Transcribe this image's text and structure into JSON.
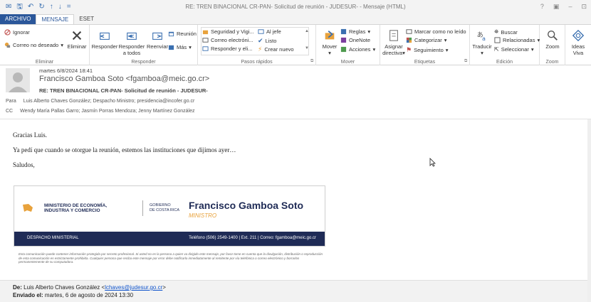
{
  "window": {
    "title": "RE: TREN BINACIONAL CR-PAN- Solicitud de reunión - JUDESUR- - Mensaje (HTML)",
    "controls": [
      "?",
      "▣",
      "–",
      "⊡"
    ]
  },
  "tabs": [
    "ARCHIVO",
    "MENSAJE",
    "ESET"
  ],
  "ribbon": {
    "eliminar": {
      "label": "Eliminar",
      "ignorar": "Ignorar",
      "correo_no_deseado": "Correo no deseado",
      "eliminar_btn": "Eliminar"
    },
    "responder": {
      "label": "Responder",
      "responder": "Responder",
      "responder_todos_1": "Responder",
      "responder_todos_2": "a todos",
      "reenviar": "Reenviar",
      "reunion": "Reunión",
      "mas": "Más"
    },
    "pasos": {
      "label": "Pasos rápidos",
      "items": [
        "Seguridad y Vigi...",
        "Correo electróni...",
        "Responder y eli...",
        "Al jefe",
        "Listo",
        "Crear nuevo"
      ]
    },
    "mover": {
      "label": "Mover",
      "mover": "Mover",
      "reglas": "Reglas",
      "onenote": "OneNote",
      "acciones": "Acciones"
    },
    "etiquetas": {
      "label": "Etiquetas",
      "asignar_1": "Asignar",
      "asignar_2": "directiva",
      "marcar": "Marcar como no leído",
      "categorizar": "Categorizar",
      "seguimiento": "Seguimiento"
    },
    "edicion": {
      "label": "Edición",
      "traducir": "Traducir",
      "buscar": "Buscar",
      "relacionadas": "Relacionadas",
      "seleccionar": "Seleccionar"
    },
    "zoom": {
      "label": "Zoom",
      "zoom": "Zoom"
    },
    "ideas": {
      "ideas_1": "Ideas",
      "ideas_2": "Viva"
    }
  },
  "message": {
    "date": "martes 6/8/2024 18:41",
    "from": "Francisco Gamboa Soto <fgamboa@meic.go.cr>",
    "subject": "RE: TREN BINACIONAL CR-PAN- Solicitud de reunión - JUDESUR-",
    "para_label": "Para",
    "para": "Luis Alberto Chaves González; Despacho Ministro; presidencia@incofer.go.cr",
    "cc_label": "CC",
    "cc": "Wendy María Pallas Garro; Jasmín Porras Mendoza; Jenny Martínez González"
  },
  "body": {
    "line1": "Gracias Luis.",
    "line2": "Ya pedí que cuando se otorgue la reunión, estemos las instituciones que dijimos ayer…",
    "line3": "Saludos,"
  },
  "signature": {
    "ministry_1": "MINISTERIO DE ECONOMÍA,",
    "ministry_2": "INDUSTRIA Y COMERCIO",
    "gov_1": "GOBIERNO",
    "gov_2": "DE COSTA RICA",
    "name": "Francisco Gamboa Soto",
    "title": "MINISTRO",
    "office": "DESPACHO MINISTERIAL",
    "contact": "Teléfono (506) 2549-1400 | Ext. 211 | Correo: fgamboa@meic.go.cr",
    "disclaimer": "Esta comunicación puede contener información protegida por secreto profesional. Si usted no es la persona a quien va dirigido este mensaje, por favor tome en cuenta que la divulgación, distribución o reproducción de esta comunicación es estrictamente prohibida. Cualquier persona que reciba este mensaje por error debe notificarlo inmediatamente al remitente por vía telefónica o correo electrónico y borrarlos permanentemente de su computadora."
  },
  "forwarded": {
    "de_label": "De:",
    "de_name": "Luis Alberto Chaves González <",
    "de_email": "lchaves@judesur.go.cr",
    "de_close": ">",
    "enviado_label": "Enviado el:",
    "enviado": "martes, 6 de agosto de 2024 13:30"
  },
  "colors": {
    "accent": "#2b579a",
    "sig_navy": "#1f2b56",
    "sig_gold": "#e8a23c"
  }
}
